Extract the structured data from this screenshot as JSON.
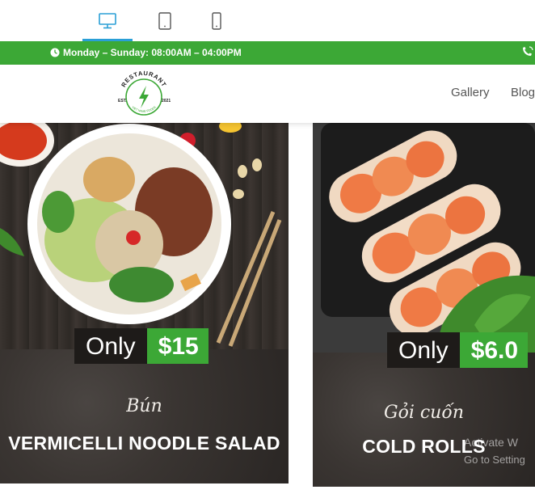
{
  "devices": [
    {
      "name": "desktop",
      "icon": "desktop-icon",
      "active": true
    },
    {
      "name": "tablet",
      "icon": "tablet-icon",
      "active": false
    },
    {
      "name": "mobile",
      "icon": "mobile-icon",
      "active": false
    }
  ],
  "info_bar": {
    "hours": "Monday – Sunday: 08:00AM – 04:00PM",
    "clock_icon": "clock-icon",
    "phone_icon": "phone-icon"
  },
  "logo": {
    "top_text": "RESTAURANT",
    "est": "EST.",
    "year": "2021",
    "bottom_text": "VIET NAME FOODS"
  },
  "nav": [
    "Gallery",
    "Blog"
  ],
  "cards": [
    {
      "price_prefix": "Only",
      "price": "$15",
      "script_name": "Bún",
      "dish_name": "VERMICELLI NOODLE SALAD"
    },
    {
      "price_prefix": "Only",
      "price": "$6.0",
      "script_name": "Gỏi cuốn",
      "dish_name": "COLD ROLLS"
    }
  ],
  "watermark": {
    "line1": "Activate W",
    "line2": "Go to Setting"
  },
  "colors": {
    "accent": "#3ca836",
    "active_tab": "#2a9fd6",
    "card_bg": "#2a2522"
  }
}
